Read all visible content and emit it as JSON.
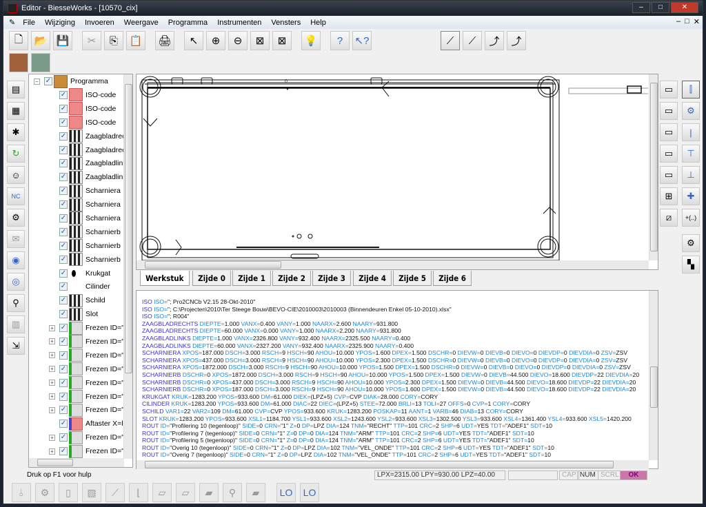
{
  "window": {
    "title": "Editor - BiesseWorks - [10570_cix]",
    "minimize": "–",
    "maximize": "□",
    "close": "✕"
  },
  "menu": [
    "File",
    "Wijziging",
    "Invoeren",
    "Weergave",
    "Programma",
    "Instrumenten",
    "Vensters",
    "Help"
  ],
  "mdi_controls": [
    "–",
    "□",
    "✕"
  ],
  "toolbar_icons": [
    "new-file",
    "open-folder",
    "save",
    "cut",
    "copy",
    "paste",
    "print",
    "pointer",
    "zoom-in",
    "zoom-out",
    "view-1",
    "view-2",
    "lightbulb",
    "help",
    "context-help",
    "tool-1",
    "tool-2",
    "tool-3",
    "tool-4"
  ],
  "tree": {
    "root": "Programma",
    "items": [
      {
        "label": "ISO-code",
        "icon": "iso",
        "expand": false
      },
      {
        "label": "ISO-code",
        "icon": "iso",
        "expand": false
      },
      {
        "label": "ISO-code",
        "icon": "iso",
        "expand": false
      },
      {
        "label": "Zaagbladrec",
        "icon": "blk",
        "expand": false
      },
      {
        "label": "Zaagbladrec",
        "icon": "blk",
        "expand": false
      },
      {
        "label": "Zaagbladlinl",
        "icon": "blk",
        "expand": false
      },
      {
        "label": "Zaagbladlinl",
        "icon": "blk",
        "expand": false
      },
      {
        "label": "Scharniera",
        "icon": "blk",
        "expand": false
      },
      {
        "label": "Scharniera",
        "icon": "blk",
        "expand": false
      },
      {
        "label": "Scharniera",
        "icon": "blk",
        "expand": false
      },
      {
        "label": "Scharnierb",
        "icon": "blk",
        "expand": false
      },
      {
        "label": "Scharnierb",
        "icon": "blk",
        "expand": false
      },
      {
        "label": "Scharnierb",
        "icon": "blk",
        "expand": false
      },
      {
        "label": "Krukgat",
        "icon": "dot",
        "expand": false
      },
      {
        "label": "Cilinder",
        "icon": "none",
        "expand": false
      },
      {
        "label": "Schild",
        "icon": "blk",
        "expand": false
      },
      {
        "label": "Slot",
        "icon": "blk",
        "expand": false
      },
      {
        "label": "Frezen ID=\"F",
        "icon": "frz",
        "expand": true
      },
      {
        "label": "Frezen ID=\"F",
        "icon": "frz",
        "expand": true
      },
      {
        "label": "Frezen ID=\"F",
        "icon": "frz",
        "expand": true
      },
      {
        "label": "Frezen ID=\"C",
        "icon": "frz",
        "expand": true
      },
      {
        "label": "Frezen ID=\"C",
        "icon": "frz",
        "expand": true
      },
      {
        "label": "Frezen ID=\"C",
        "icon": "frz",
        "expand": true
      },
      {
        "label": "Frezen ID=\"C",
        "icon": "frz",
        "expand": true
      },
      {
        "label": "Aftaster X=lp",
        "icon": "aft",
        "expand": false
      },
      {
        "label": "Frezen ID=\"A",
        "icon": "frz",
        "expand": true
      },
      {
        "label": "Frezen ID=\"A",
        "icon": "frz",
        "expand": true
      }
    ]
  },
  "drawing": {
    "top_label": "0"
  },
  "tabs": [
    "Werkstuk",
    "Zijde 0",
    "Zijde 1",
    "Zijde 2",
    "Zijde 3",
    "Zijde 4",
    "Zijde 5",
    "Zijde 6"
  ],
  "code_lines": [
    "ISO ISO=\"; Pro2CNCb V2.15 28-Okt-2010\"",
    "ISO ISO=\"; C:\\Projecten\\2010\\Ter Steege Bouw\\BEVO-CIE\\2010003\\2010003 (Binnendeuren Enkel 05-10-2010).xlsx\"",
    "ISO ISO=\"; R004\"",
    "ZAAGBLADRECHTS DIEPTE=1.000 VANX=0.400 VANY=1.000 NAARX=2.600 NAARY=931.800",
    "ZAAGBLADRECHTS DIEPTE=60.000 VANX=0.000 VANY=1.000 NAARX=2.200 NAARY=931.800",
    "ZAAGBLADLINKS DIEPTE=1.000 VANX=2326.800 VANY=932.400 NAARX=2325.500 NAARY=0.400",
    "ZAAGBLADLINKS DIEPTE=60.000 VANX=2327.200 VANY=932.400 NAARX=2325.900 NAARY=0.400",
    "SCHARNIERA XPOS=187.000 DSCH=3.000 RSCH=9 HSCH=90 AHOU=10.000 YPOS=1.600 DPEX=1.500 DSCHR=0 DIEVW=0 DIEVB=0 DIEVO=0 DIEVDP=0 DIEVDIA=0 ZSV=ZSV",
    "SCHARNIERA XPOS=437.000 DSCH=3.000 RSCH=9 HSCH=90 AHOU=10.000 YPOS=2.300 DPEX=1.500 DSCHR=0 DIEVW=0 DIEVB=0 DIEVO=0 DIEVDP=0 DIEVDIA=0 ZSV=ZSV",
    "SCHARNIERA XPOS=1872.000 DSCH=3.000 RSCH=9 HSCH=90 AHOU=10.000 YPOS=1.500 DPEX=1.500 DSCHR=0 DIEVW=0 DIEVB=0 DIEVO=0 DIEVDP=0 DIEVDIA=0 ZSV=ZSV",
    "SCHARNIERB DSCHR=0 XPOS=1872.000 DSCH=3.000 RSCH=9 HSCH=90 AHOU=10.000 YPOS=1.500 DPEX=1.500 DIEVW=0 DIEVB=44.500 DIEVO=18.600 DIEVDP=22 DIEVDIA=20",
    "SCHARNIERB DSCHR=0 XPOS=437.000 DSCH=3.000 RSCH=9 HSCH=90 AHOU=10.000 YPOS=2.300 DPEX=1.500 DIEVW=0 DIEVB=44.500 DIEVO=18.600 DIEVDP=22 DIEVDIA=20",
    "SCHARNIERB DSCHR=0 XPOS=187.000 DSCH=3.000 RSCH=9 HSCH=90 AHOU=10.000 YPOS=1.600 DPEX=1.500 DIEVW=0 DIEVB=44.500 DIEVO=18.600 DIEVDP=22 DIEVDIA=20",
    "KRUKGAT KRUK=1283.200 YPOS=933.600 DM=61.000 DIEK=(LPZ+5) CVP=CVP DIAK=28.000 CORY=CORY",
    "CILINDER KRUK=1283.200 YPOS=933.600 DM=61.000 DIAC=22 DIEC=(LPZ+5) STEE=72.000 BRLI=13 TOLI=27 OFFS=0 CVP=1 CORY=CORY",
    "SCHILD VAR1=22 VAR2=109 DM=61.000 CVP=CVP YPOS=933.600 KRUK=1283.200 POSKAP=11 AANT=1 VARB=46 DIAB=13 CORY=CORY",
    "SLOT KRUK=1283.200 YPOS=933.600 XSL1=1184.700 YSL1=933.600 XSL2=1243.600 YSL2=933.600 XSL3=1302.500 YSL3=933.600 XSL4=1361.400 YSL4=933.600 XSL5=1420.200",
    "ROUT ID=\"Profilering 10 (tegenloop)\" SIDE=0 CRN=\"1\" Z=0 DP=LPZ DIA=124 TNM=\"RECHT\" TTP=101 CRC=2 SHP=6 UDT=YES TDT=\"ADEF1\" SDT=10",
    "ROUT ID=\"Profilering 7 (tegenloop)\" SIDE=0 CRN=\"1\" Z=0 DP=0 DIA=124 TNM=\"ARM\" TTP=101 CRC=2 SHP=6 UDT=YES TDT=\"ADEF1\" SDT=10",
    "ROUT ID=\"Profilering 5 (tegenloop)\" SIDE=0 CRN=\"1\" Z=0 DP=0 DIA=124 TNM=\"ARM\" TTP=101 CRC=2 SHP=6 UDT=YES TDT=\"ADEF1\" SDT=10",
    "ROUT ID=\"Overig 10 (tegenloop)\" SIDE=0 CRN=\"1\" Z=0 DP=LPZ DIA=102 TNM=\"VEL_ONDE\" TTP=101 CRC=2 SHP=6 UDT=YES TDT=\"ADEF1\" SDT=10",
    "ROUT ID=\"Overig 7 (tegenloop)\" SIDE=0 CRN=\"1\" Z=0 DP=LPZ DIA=102 TNM=\"VEL_ONDE\" TTP=101 CRC=2 SHP=6 UDT=YES TDT=\"ADEF1\" SDT=10"
  ],
  "status": {
    "help": "Druk op F1 voor hulp",
    "coords": "LPX=2315.00  LPY=930.00  LPZ=40.00",
    "cap": "CAP",
    "num": "NUM",
    "scrl": "SCRL",
    "ok": "OK"
  },
  "colors": {
    "keyword": "#3a2fd0",
    "param": "#1e88d0",
    "ok": "#800080"
  }
}
